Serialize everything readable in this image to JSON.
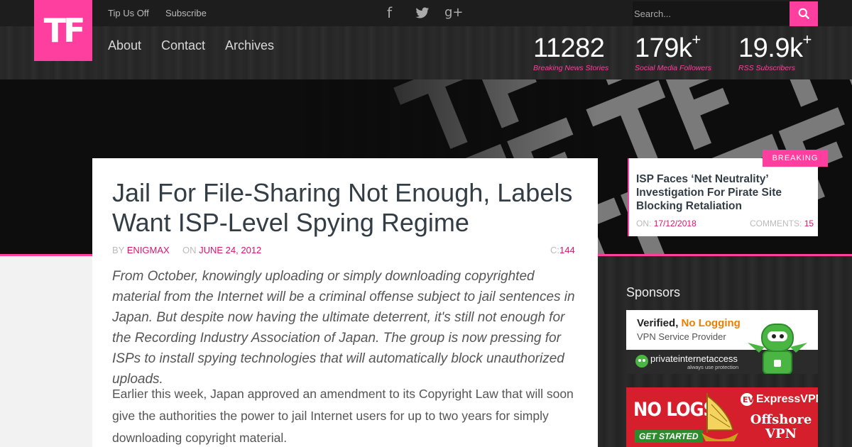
{
  "logo": "TF",
  "topbar": {
    "links": [
      "Tip Us Off",
      "Subscribe"
    ],
    "social": [
      "facebook-icon",
      "twitter-icon",
      "google-plus-icon"
    ],
    "search_placeholder": "Search..."
  },
  "nav": [
    "About",
    "Contact",
    "Archives"
  ],
  "stats": [
    {
      "value": "11282",
      "plus": "",
      "label": "Breaking News Stories"
    },
    {
      "value": "179k",
      "plus": "+",
      "label": "Social Media Followers"
    },
    {
      "value": "19.9k",
      "plus": "+",
      "label": "RSS Subscribers"
    }
  ],
  "article": {
    "title": "Jail For File-Sharing Not Enough, Labels Want ISP-Level Spying Regime",
    "by_label": "BY",
    "author": "ENIGMAX",
    "on_label": "ON",
    "date": "JUNE 24, 2012",
    "comments_label": "C:",
    "comments": "144",
    "lead": "From October, knowingly uploading or simply downloading copyrighted material from the Internet will be a criminal offense subject to jail sentences in Japan. But despite now having the ultimate deterrent, it's still not enough for the Recording Industry Association of Japan. The group is now pressing for ISPs to install spying technologies that will automatically block unauthorized uploads.",
    "paragraph": "Earlier this week, Japan approved an amendment to its Copyright Law that will soon give the authorities the power to jail Internet users for up to two years for simply downloading copyright material."
  },
  "breaking": {
    "tag": "BREAKING",
    "title": "ISP Faces ‘Net Neutrality’ Investigation For Pirate Site Blocking Retaliation",
    "on_label": "ON:",
    "date": "17/12/2018",
    "comments_label": "COMMENTS:",
    "comments": "15"
  },
  "sponsors": {
    "title": "Sponsors",
    "ad1": {
      "headline_a": "Verified,",
      "headline_b": "No Logging",
      "sub": "VPN Service Provider",
      "brand": "privateinternetaccess",
      "tagline": "always use protection"
    },
    "ad2": {
      "headline": "NO LOGS",
      "cta": "GET STARTED",
      "brand": "ExpressVPN",
      "offer_a": "Offshore",
      "offer_b": "VPN"
    }
  },
  "colors": {
    "accent": "#ff3fa0",
    "accent_text": "#d6166e",
    "title": "#333d45"
  }
}
